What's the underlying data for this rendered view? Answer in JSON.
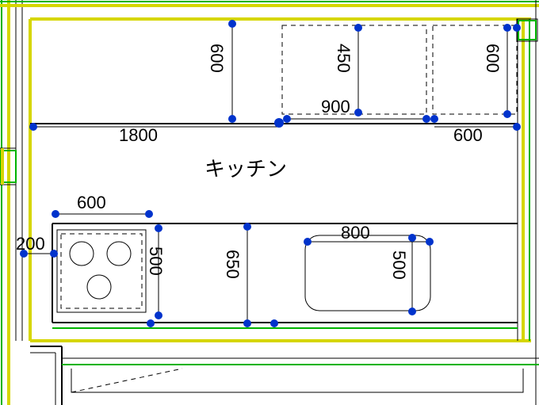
{
  "room": {
    "name": "キッチン"
  },
  "dimensions": {
    "upper": {
      "wall_cabinet_width": "1800",
      "wall_cabinet_depth": "600",
      "hanging_unit_width": "900",
      "hanging_unit_depth": "450",
      "right_unit_width": "600",
      "right_unit_depth": "600"
    },
    "lower": {
      "cooktop_width": "600",
      "cooktop_offset": "200",
      "cooktop_depth": "500",
      "counter_depth": "650",
      "sink_width": "800",
      "sink_depth": "500"
    }
  }
}
